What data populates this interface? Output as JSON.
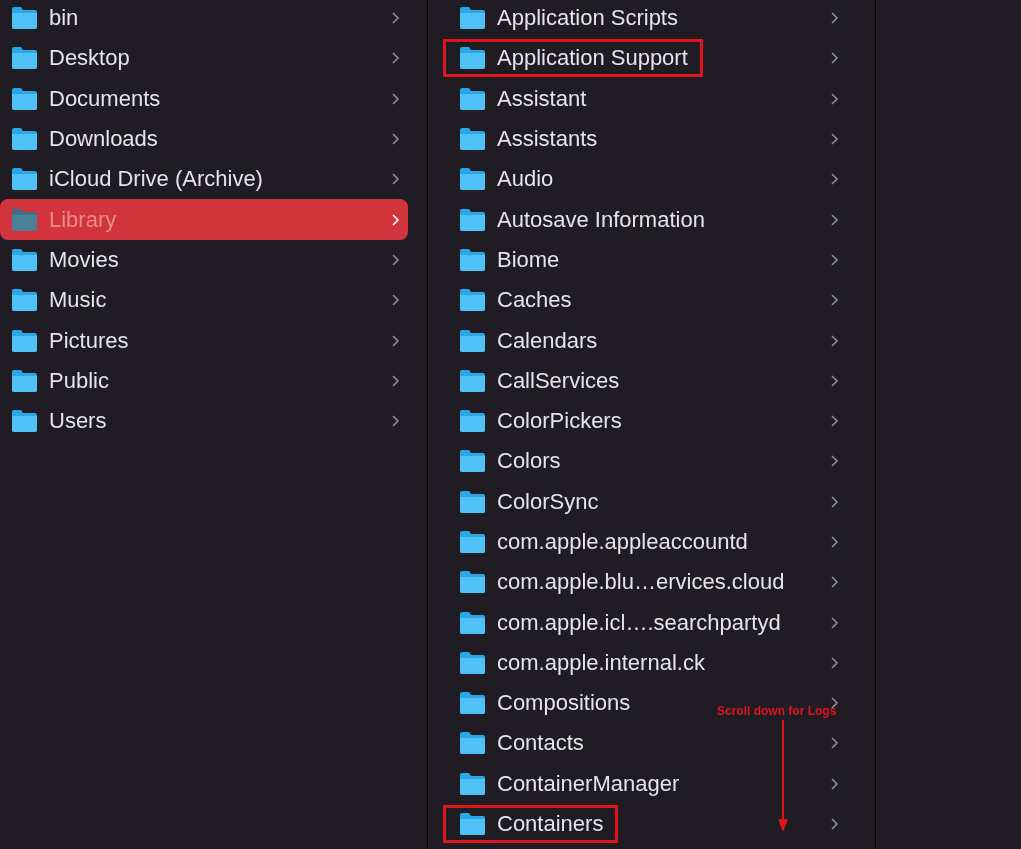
{
  "columns": [
    {
      "items": [
        {
          "name": "bin",
          "selected": false
        },
        {
          "name": "Desktop",
          "selected": false
        },
        {
          "name": "Documents",
          "selected": false
        },
        {
          "name": "Downloads",
          "selected": false
        },
        {
          "name": "iCloud Drive (Archive)",
          "selected": false
        },
        {
          "name": "Library",
          "selected": true
        },
        {
          "name": "Movies",
          "selected": false
        },
        {
          "name": "Music",
          "selected": false
        },
        {
          "name": "Pictures",
          "selected": false
        },
        {
          "name": "Public",
          "selected": false
        },
        {
          "name": "Users",
          "selected": false
        }
      ]
    },
    {
      "items": [
        {
          "name": "Application Scripts",
          "selected": false,
          "highlighted": false
        },
        {
          "name": "Application Support",
          "selected": false,
          "highlighted": true
        },
        {
          "name": "Assistant",
          "selected": false,
          "highlighted": false
        },
        {
          "name": "Assistants",
          "selected": false,
          "highlighted": false
        },
        {
          "name": "Audio",
          "selected": false,
          "highlighted": false
        },
        {
          "name": "Autosave Information",
          "selected": false,
          "highlighted": false
        },
        {
          "name": "Biome",
          "selected": false,
          "highlighted": false
        },
        {
          "name": "Caches",
          "selected": false,
          "highlighted": false
        },
        {
          "name": "Calendars",
          "selected": false,
          "highlighted": false
        },
        {
          "name": "CallServices",
          "selected": false,
          "highlighted": false
        },
        {
          "name": "ColorPickers",
          "selected": false,
          "highlighted": false
        },
        {
          "name": "Colors",
          "selected": false,
          "highlighted": false
        },
        {
          "name": "ColorSync",
          "selected": false,
          "highlighted": false
        },
        {
          "name": "com.apple.appleaccountd",
          "selected": false,
          "highlighted": false
        },
        {
          "name": "com.apple.blu…ervices.cloud",
          "selected": false,
          "highlighted": false
        },
        {
          "name": "com.apple.icl….searchpartyd",
          "selected": false,
          "highlighted": false
        },
        {
          "name": "com.apple.internal.ck",
          "selected": false,
          "highlighted": false
        },
        {
          "name": "Compositions",
          "selected": false,
          "highlighted": false
        },
        {
          "name": "Contacts",
          "selected": false,
          "highlighted": false
        },
        {
          "name": "ContainerManager",
          "selected": false,
          "highlighted": false
        },
        {
          "name": "Containers",
          "selected": false,
          "highlighted": true
        }
      ]
    }
  ],
  "annotation": {
    "text": "Scroll down for Logs"
  }
}
